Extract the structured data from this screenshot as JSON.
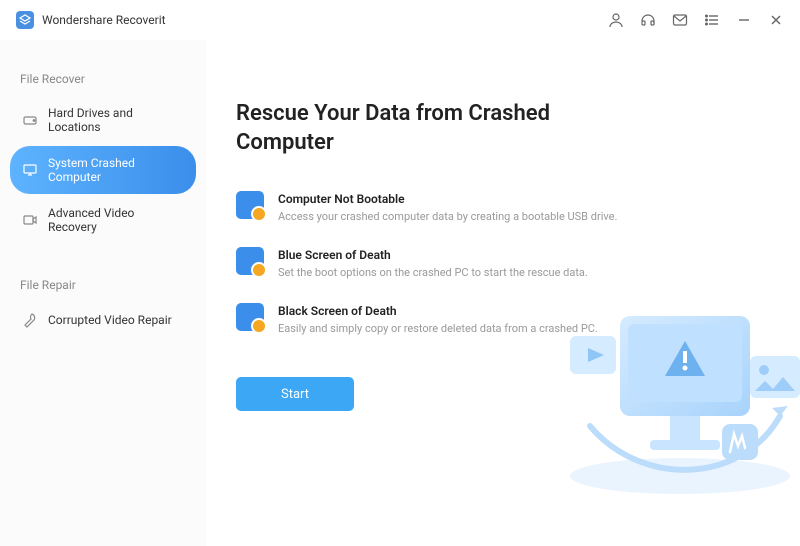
{
  "app": {
    "title": "Wondershare Recoverit"
  },
  "titlebar": {
    "icons": [
      "user",
      "headset",
      "mail",
      "list",
      "minimize",
      "close"
    ]
  },
  "sidebar": {
    "sections": [
      {
        "label": "File Recover",
        "items": [
          {
            "id": "hard-drives",
            "label": "Hard Drives and Locations",
            "active": false
          },
          {
            "id": "crashed",
            "label": "System Crashed Computer",
            "active": true
          },
          {
            "id": "video-recovery",
            "label": "Advanced Video Recovery",
            "active": false
          }
        ]
      },
      {
        "label": "File Repair",
        "items": [
          {
            "id": "video-repair",
            "label": "Corrupted Video Repair",
            "active": false
          }
        ]
      }
    ]
  },
  "main": {
    "title": "Rescue Your Data from Crashed Computer",
    "features": [
      {
        "title": "Computer Not Bootable",
        "desc": "Access your crashed computer data by creating a bootable USB drive."
      },
      {
        "title": "Blue Screen of Death",
        "desc": "Set the boot options on the crashed PC to start the rescue data."
      },
      {
        "title": "Black Screen of Death",
        "desc": "Easily and simply copy or restore deleted data from a crashed PC."
      }
    ],
    "start_label": "Start"
  },
  "colors": {
    "accent": "#3ba7f5"
  }
}
